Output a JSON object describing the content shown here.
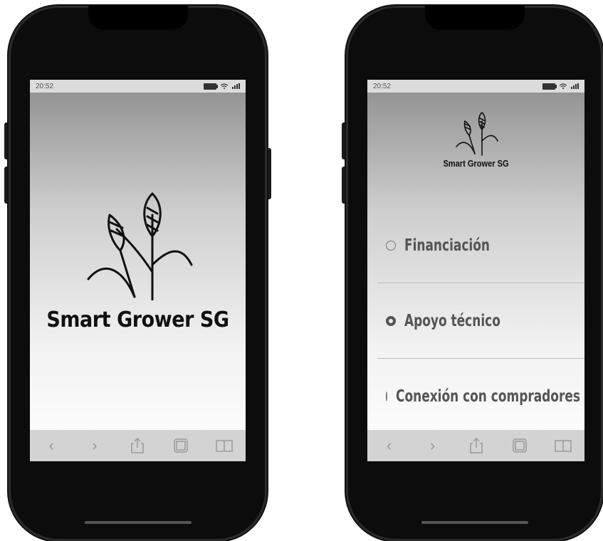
{
  "phones": [
    {
      "status_time": "20:52",
      "brand": "Smart Grower SG",
      "toolbar": [
        "back-icon",
        "forward-icon",
        "share-icon",
        "tabs-icon",
        "bookmarks-icon"
      ]
    },
    {
      "status_time": "20:52",
      "brand": "Smart Grower SG",
      "menu": [
        {
          "label": "Financiación",
          "selected": false
        },
        {
          "label": "Apoyo técnico",
          "selected": true
        },
        {
          "label": "Conexión con compradores",
          "selected": false
        }
      ],
      "toolbar": [
        "back-icon",
        "forward-icon",
        "share-icon",
        "tabs-icon",
        "bookmarks-icon"
      ]
    }
  ],
  "colors": {
    "frame": "#0c0c0c",
    "toolbar": "#d3d3d3",
    "statusbar": "#dcdcdc",
    "text": "#111111"
  }
}
